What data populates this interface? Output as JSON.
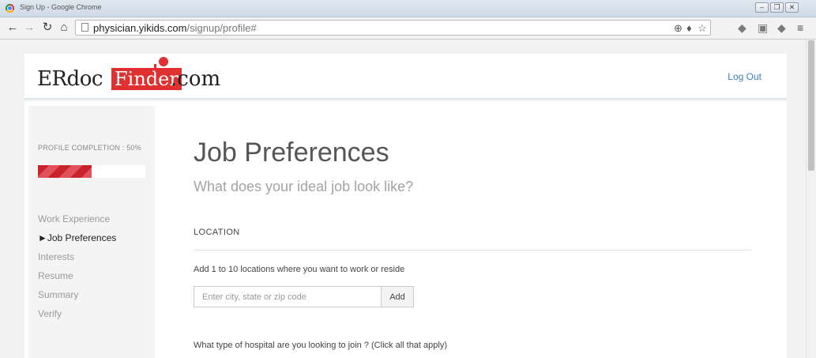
{
  "window": {
    "title": "Sign Up - Google Chrome",
    "controls": [
      "–",
      "❐",
      "✕"
    ]
  },
  "browser": {
    "url_host": "physician.yikids.com",
    "url_path": "/signup/profile#",
    "nav_icons": [
      "back-icon",
      "forward-icon",
      "reload-icon",
      "home-icon"
    ],
    "toolbar_icons": [
      "zoom-icon",
      "extension-icon",
      "star-icon",
      "extension-icon",
      "extension-icon",
      "extension-icon",
      "menu-icon"
    ]
  },
  "header": {
    "logo": {
      "prefix": "ERdoc",
      "box": "Finder",
      "suffix": ".com"
    },
    "logout_label": "Log Out"
  },
  "sidebar": {
    "completion_label": "PROFILE COMPLETION : 50%",
    "completion_value": 0.5,
    "steps": [
      {
        "label": "Work Experience",
        "active": false
      },
      {
        "label": "►Job Preferences",
        "active": true
      },
      {
        "label": "Interests",
        "active": false
      },
      {
        "label": "Resume",
        "active": false
      },
      {
        "label": "Summary",
        "active": false
      },
      {
        "label": "Verify",
        "active": false
      }
    ]
  },
  "main": {
    "title": "Job Preferences",
    "subtitle": "What does your ideal job look like?",
    "location_section": "LOCATION",
    "location_instruction": "Add 1 to 10 locations where you want to work or reside",
    "location_placeholder": "Enter city, state or zip code",
    "location_value": "",
    "add_label": "Add",
    "hospital_question": "What type of hospital are you looking to join ? (Click all that apply)"
  },
  "colors": {
    "brand_red": "#e03030",
    "link_blue": "#3a7fbf"
  }
}
